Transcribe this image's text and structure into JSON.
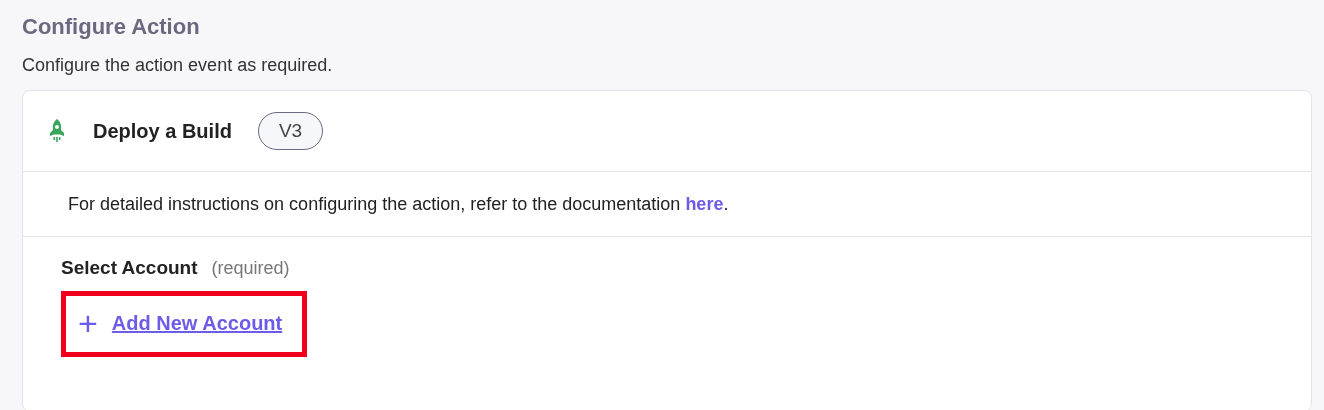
{
  "header": {
    "title": "Configure Action",
    "subtitle": "Configure the action event as required."
  },
  "action": {
    "name": "Deploy a Build",
    "version": "V3"
  },
  "info": {
    "text": "For detailed instructions on configuring the action, refer to the documentation ",
    "link": "here",
    "end": "."
  },
  "account": {
    "label": "Select Account",
    "hint": "(required)",
    "add_icon": "+",
    "add_link": "Add New Account",
    "highlighted": true
  }
}
